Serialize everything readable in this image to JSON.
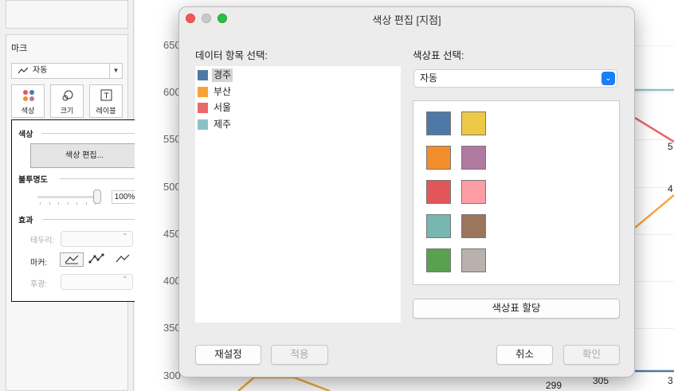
{
  "left_panel": {
    "marks_title": "마크",
    "mark_type": "자동",
    "mark_buttons": [
      {
        "label": "색상",
        "icon": "color-icon"
      },
      {
        "label": "크기",
        "icon": "size-icon"
      },
      {
        "label": "레이블",
        "icon": "label-icon"
      }
    ]
  },
  "color_popup": {
    "color_section": "색상",
    "edit_colors_button": "색상 편집...",
    "opacity_section": "불투명도",
    "opacity_value": "100%",
    "opacity_level": 1.0,
    "effects_section": "효과",
    "border_label": "테두리:",
    "markers_label": "마커:",
    "halo_label": "후광:"
  },
  "chart": {
    "y_ticks": [
      "650",
      "600",
      "550",
      "500",
      "450",
      "400",
      "350",
      "300"
    ],
    "labels": [
      {
        "text": "5",
        "id": "r1"
      },
      {
        "text": "4",
        "id": "r2"
      },
      {
        "text": "299",
        "id": "b1"
      },
      {
        "text": "305",
        "id": "b2"
      },
      {
        "text": "3",
        "id": "b3"
      }
    ],
    "colors": {
      "blue": "#4e79a7",
      "orange": "#f5a83a",
      "red": "#e15759",
      "teal": "#76b7b2"
    }
  },
  "dialog": {
    "title": "색상 편집 [지점]",
    "items_label": "데이터 항목 선택:",
    "palette_label": "색상표 선택:",
    "palette_value": "자동",
    "items": [
      {
        "label": "경주",
        "color": "#4e79a7",
        "selected": true
      },
      {
        "label": "부산",
        "color": "#f6a43a",
        "selected": false
      },
      {
        "label": "서울",
        "color": "#e8696b",
        "selected": false
      },
      {
        "label": "제주",
        "color": "#8bc3c5",
        "selected": false
      }
    ],
    "swatches": [
      "#4e79a7",
      "#edc948",
      "#f28e2b",
      "#b07aa1",
      "#e15759",
      "#ff9da7",
      "#76b7b2",
      "#9c755f",
      "#59a14f",
      "#bab0ac"
    ],
    "assign_button": "색상표 할당",
    "reset_button": "재설정",
    "apply_button": "적용",
    "cancel_button": "취소",
    "ok_button": "확인"
  }
}
